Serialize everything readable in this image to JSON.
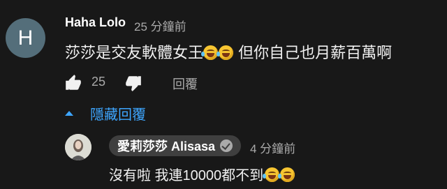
{
  "comment": {
    "avatar_letter": "H",
    "author": "Haha Lolo",
    "time": "25 分鐘前",
    "text_part1": "莎莎是交友軟體女王",
    "text_part2": " 但你自己也月薪百萬啊",
    "like_count": "25",
    "reply_label": "回覆",
    "hide_replies_label": "隱藏回覆"
  },
  "reply": {
    "author": "愛莉莎莎 Alisasa",
    "verified": true,
    "time": "4 分鐘前",
    "text": "沒有啦 我連10000都不到"
  },
  "colors": {
    "background": "#181818",
    "link_blue": "#3ea6ff",
    "avatar_main": "#546e7a",
    "secondary_text": "#aaaaaa"
  },
  "icons": [
    "thumbs-up-icon",
    "thumbs-down-icon",
    "caret-up-icon",
    "verified-check-icon",
    "rofl-emoji-icon"
  ]
}
